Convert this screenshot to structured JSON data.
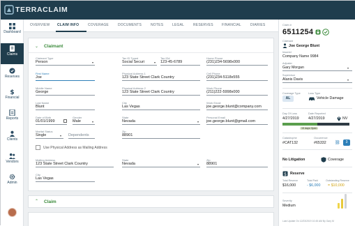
{
  "app": {
    "name": "TERRACLAIM",
    "brand_color": "#1f3d4d",
    "accent_green": "#3a8a3a"
  },
  "sidebar": {
    "items": [
      {
        "label": "Dashboard",
        "icon": "dashboard-icon"
      },
      {
        "label": "Claims",
        "icon": "claims-icon",
        "active": true
      },
      {
        "label": "Reserves",
        "icon": "reserves-icon"
      },
      {
        "label": "Financial",
        "icon": "dollar-icon"
      },
      {
        "label": "Reports",
        "icon": "reports-icon"
      },
      {
        "label": "Clients",
        "icon": "clients-icon"
      },
      {
        "label": "Vendors",
        "icon": "vendors-icon"
      },
      {
        "label": "Admin",
        "icon": "gear-icon"
      }
    ]
  },
  "tabs": {
    "items": [
      "OVERVIEW",
      "CLAIM INFO",
      "COVERAGE",
      "DOCUMENTS",
      "NOTES",
      "LEGAL",
      "RESERVES",
      "FINANCIAL",
      "DIARIES"
    ],
    "active": "CLAIM INFO"
  },
  "claimant": {
    "section_title": "Claimant",
    "claimant_type": {
      "label": "Claimant Type",
      "value": "Person"
    },
    "tax_id_type": {
      "label": "Tax ID Typed",
      "value": "Social Securi"
    },
    "tax_id": {
      "label": "Tax ID#",
      "value": "123-45-6789"
    },
    "home_phone": {
      "label": "Home Phone",
      "value": "(231)234-5698x000"
    },
    "first_name": {
      "label": "First Name",
      "value": "Joe"
    },
    "physical_address_1": {
      "label": "Physical Address 1",
      "value": "123 State Street Clark Country"
    },
    "cell_phone": {
      "label": "Cell Phone",
      "value": "(231)234-5118x555"
    },
    "middle_name": {
      "label": "Middle Name",
      "value": "George"
    },
    "physical_address_2": {
      "label": "Physical Address 2",
      "value": "123 State Street Clark Country"
    },
    "work_phone": {
      "label": "Work Phone",
      "value": "(211)222-5998x000"
    },
    "last_name": {
      "label": "Last Name",
      "value": "Blunt"
    },
    "city": {
      "label": "City",
      "value": "Las Vegas"
    },
    "work_email": {
      "label": "Work Email",
      "value": "joe.george.blunt@company.com"
    },
    "dob": {
      "label": "Date of Birth",
      "value": "01/01/1999"
    },
    "gender": {
      "label": "Gender",
      "value": "Male"
    },
    "state": {
      "label": "State",
      "value": "Nevada"
    },
    "personal_email": {
      "label": "Personal Email",
      "value": "joe.george.blunt@gmail.com"
    },
    "marital_status": {
      "label": "Marital Status",
      "value": "Single"
    },
    "dependents": {
      "placeholder": "Dependents"
    },
    "zip": {
      "label": "Zip",
      "value": "88901"
    },
    "same_as_physical": {
      "label": "Use Physical Address as Mailing Address"
    },
    "mailing_address": {
      "label": "Mailing Address",
      "value": "123 State Street Clark Country"
    },
    "mailing_state": {
      "label": "State",
      "value": "Nevada"
    },
    "mailing_zip": {
      "label": "Zip",
      "value": "88901"
    },
    "mailing_city": {
      "label": "City",
      "value": "Las Vegas"
    }
  },
  "claim_section": {
    "title": "Claim"
  },
  "right_panel": {
    "claim_label": "Claim #",
    "claim_number": "6511254",
    "claimant_label": "Claimant",
    "claimant_name": "Joe George Blunt",
    "insured_label": "Insured",
    "insured_value": "Company Name 9984",
    "adjuster_label": "Adjuster",
    "adjuster_value": "Gary Morgan",
    "supervisor_label": "Supervisor",
    "supervisor_value": "Alanis Davis",
    "coverage_type_label": "Coverage Type",
    "coverage_type_value": "AL",
    "loss_type_label": "Loss Type",
    "loss_type_value": "Vehicle Damage",
    "day_of_loss_label": "Day Of Loss",
    "day_of_loss_value": "4/27/2019",
    "date_reported_label": "Date Reported",
    "date_reported_value": "4/27/2019",
    "state_value": "NV",
    "days_open": "15 days Open",
    "days_open_fraction": 0.52,
    "catastrophe_label": "Catastrophe",
    "catastrophe_value": "#CAT132",
    "occurrence_label": "Occurrence",
    "occurrence_value": "#65332",
    "occurrence_count": "3",
    "litigation_value": "No Litigation",
    "coverage_link": "Coverage",
    "reserve_title": "Reserve",
    "total_reserve_label": "Total Reserve",
    "total_reserve_value": "$16,000",
    "total_paid_label": "Total Paid",
    "total_paid_value": "- $6,000",
    "outstanding_label": "Outstanding Reserve",
    "outstanding_value": "= $10,000",
    "severity_label": "Severity",
    "severity_value": "Medium",
    "last_update": "Last Update On 12/23/2019 10:45 AM By Gary M"
  }
}
